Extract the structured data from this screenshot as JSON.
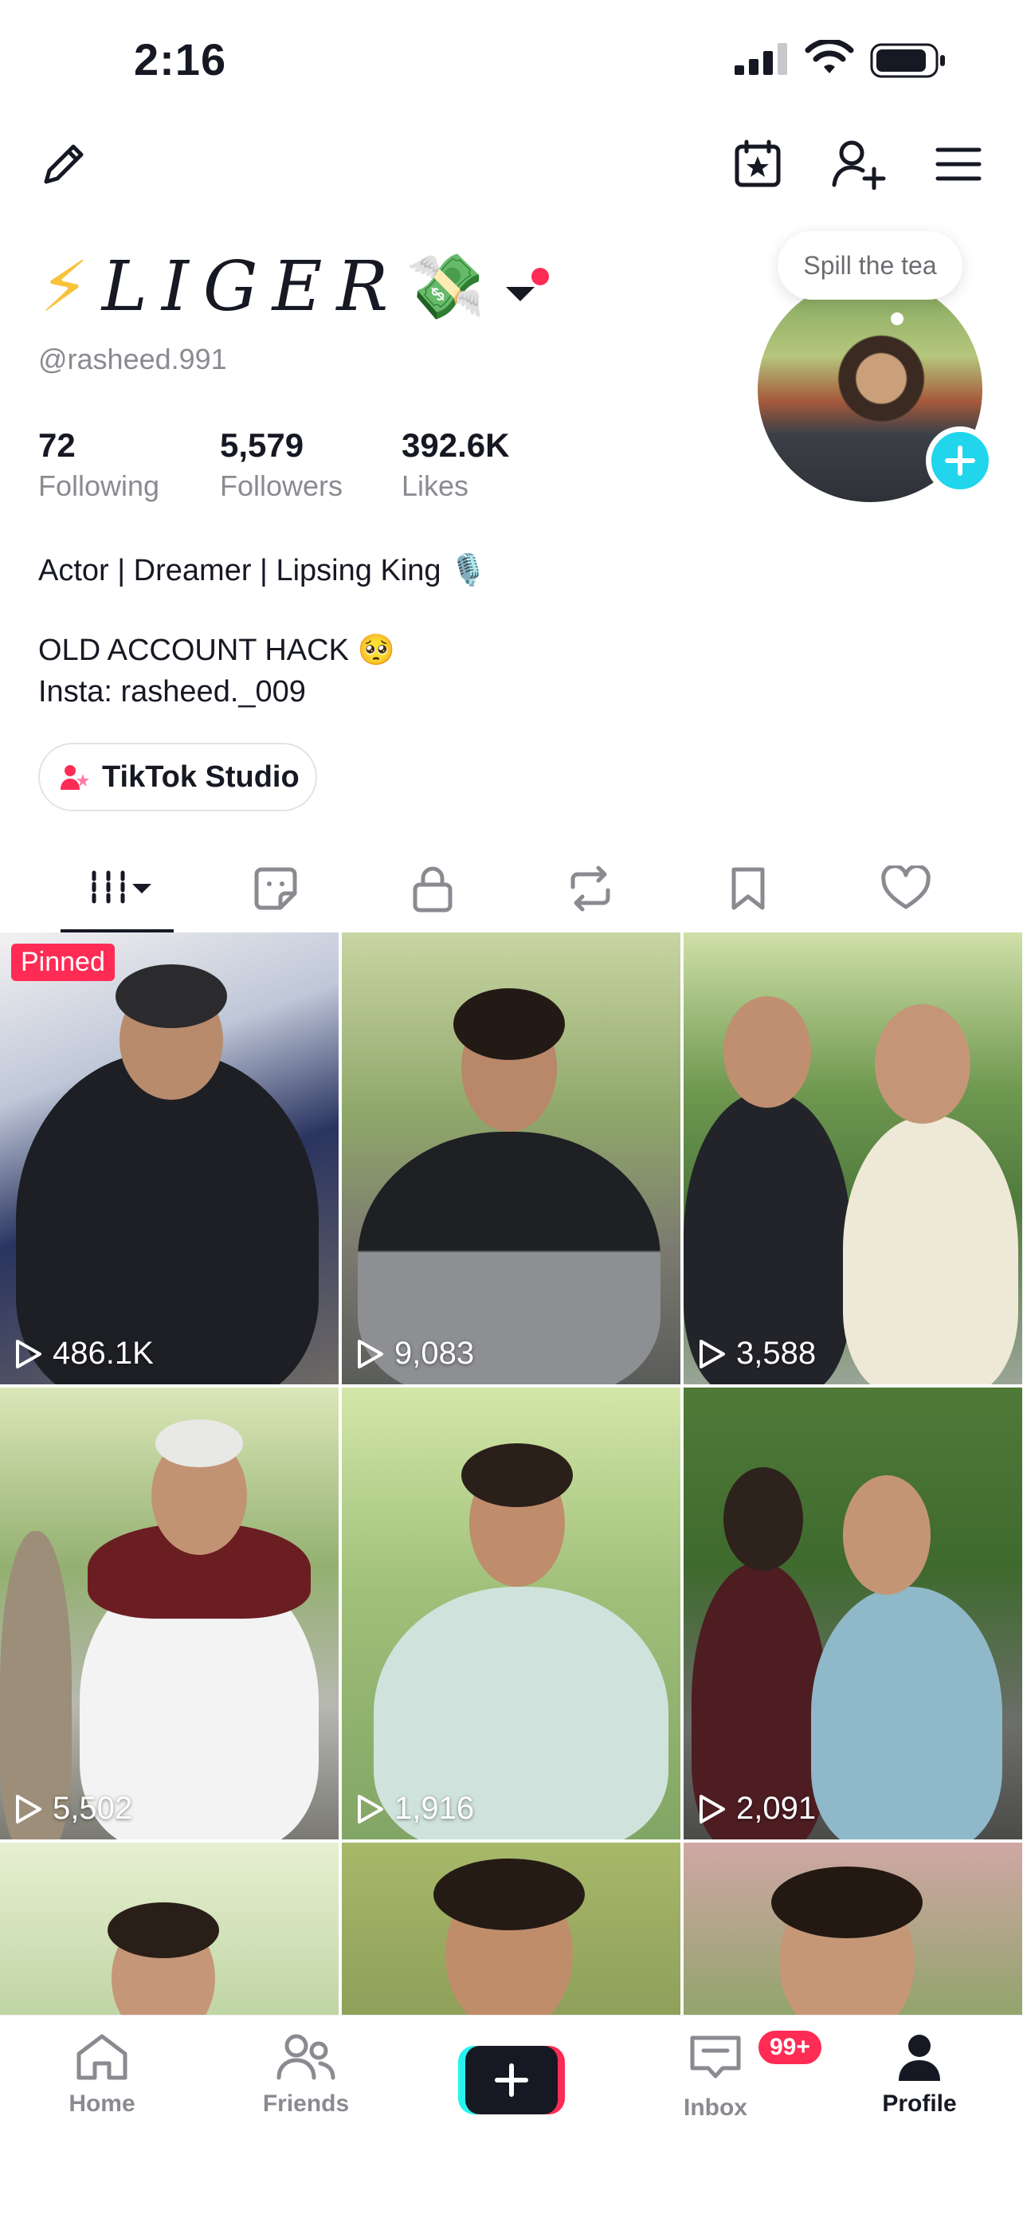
{
  "status_bar": {
    "time": "2:16"
  },
  "profile": {
    "display_name": "LIGER",
    "name_prefix_emoji": "⚡",
    "name_suffix_emoji": "💸",
    "username": "@rasheed.991",
    "tea_bubble": "Spill the tea",
    "stats": {
      "following": {
        "value": "72",
        "label": "Following"
      },
      "followers": {
        "value": "5,579",
        "label": "Followers"
      },
      "likes": {
        "value": "392.6K",
        "label": "Likes"
      }
    },
    "bio": {
      "line1": "Actor | Dreamer | Lipsing King 🎙️",
      "line2": "OLD ACCOUNT HACK 🥺",
      "line3": "Insta: rasheed._009"
    },
    "studio_button": "TikTok Studio"
  },
  "tabs": [
    "videos-tab",
    "reposts-sticker-tab",
    "private-tab",
    "repost-tab",
    "saved-tab",
    "liked-tab"
  ],
  "videos": [
    {
      "views": "486.1K",
      "pinned": true,
      "pinned_label": "Pinned"
    },
    {
      "views": "9,083"
    },
    {
      "views": "3,588"
    },
    {
      "views": "5,502"
    },
    {
      "views": "1,916"
    },
    {
      "views": "2,091"
    },
    {
      "views": ""
    },
    {
      "views": ""
    },
    {
      "views": ""
    }
  ],
  "bottom_nav": {
    "home": "Home",
    "friends": "Friends",
    "inbox": "Inbox",
    "inbox_badge": "99+",
    "profile": "Profile"
  },
  "colors": {
    "accent": "#fe2c55",
    "cyan": "#20d5ec",
    "text": "#161823",
    "muted": "#8a8b91"
  }
}
